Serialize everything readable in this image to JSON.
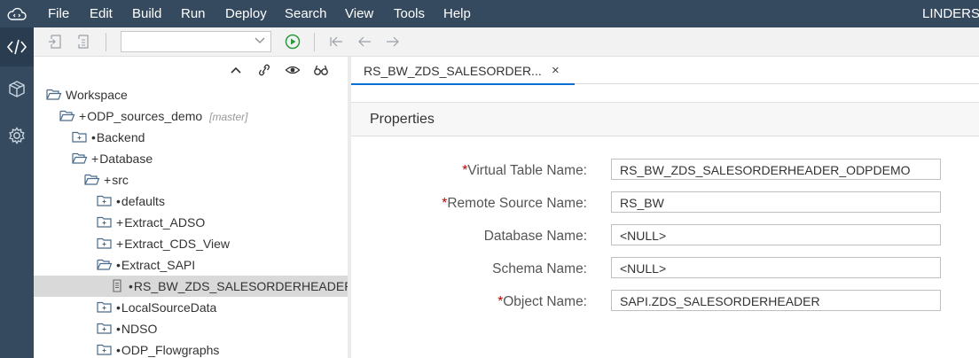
{
  "menubar": {
    "items": [
      "File",
      "Edit",
      "Build",
      "Run",
      "Deploy",
      "Search",
      "View",
      "Tools",
      "Help"
    ],
    "user": "LINDERS"
  },
  "sidebar": {
    "items": [
      {
        "icon": "code-icon",
        "active": true
      },
      {
        "icon": "package-icon",
        "active": false
      },
      {
        "icon": "gear-icon",
        "active": false
      }
    ]
  },
  "toolbar": {
    "combo_value": "",
    "icons": [
      "new-file-icon",
      "copy-file-icon",
      "run-icon",
      "jump-back-icon",
      "back-icon",
      "forward-icon"
    ]
  },
  "tree": {
    "rows": [
      {
        "label": "Workspace",
        "prefix": "",
        "icon": "folder-open",
        "branch": ""
      },
      {
        "label": "ODP_sources_demo",
        "prefix": "+",
        "icon": "folder-open",
        "branch": "[master]"
      },
      {
        "label": "Backend",
        "prefix": "•",
        "icon": "folder-closed",
        "branch": ""
      },
      {
        "label": "Database",
        "prefix": "+",
        "icon": "folder-open",
        "branch": ""
      },
      {
        "label": "src",
        "prefix": "+",
        "icon": "folder-open",
        "branch": ""
      },
      {
        "label": "defaults",
        "prefix": "•",
        "icon": "folder-closed",
        "branch": ""
      },
      {
        "label": "Extract_ADSO",
        "prefix": "+",
        "icon": "folder-closed",
        "branch": ""
      },
      {
        "label": "Extract_CDS_View",
        "prefix": "+",
        "icon": "folder-closed",
        "branch": ""
      },
      {
        "label": "Extract_SAPI",
        "prefix": "•",
        "icon": "folder-open",
        "branch": ""
      },
      {
        "label": "RS_BW_ZDS_SALESORDERHEADER_ODPDEMO.hdbvirtualtable",
        "prefix": "•",
        "icon": "file",
        "branch": "",
        "selected": true
      },
      {
        "label": "LocalSourceData",
        "prefix": "•",
        "icon": "folder-closed",
        "branch": ""
      },
      {
        "label": "NDSO",
        "prefix": "•",
        "icon": "folder-closed",
        "branch": ""
      },
      {
        "label": "ODP_Flowgraphs",
        "prefix": "•",
        "icon": "folder-closed",
        "branch": ""
      }
    ]
  },
  "editor": {
    "tab_label": "RS_BW_ZDS_SALESORDER...",
    "close_glyph": "×",
    "section_title": "Properties",
    "fields": [
      {
        "label": "Virtual Table Name:",
        "required": true,
        "value": "RS_BW_ZDS_SALESORDERHEADER_ODPDEMO"
      },
      {
        "label": "Remote Source Name:",
        "required": true,
        "value": "RS_BW"
      },
      {
        "label": "Database Name:",
        "required": false,
        "value": "<NULL>"
      },
      {
        "label": "Schema Name:",
        "required": false,
        "value": "<NULL>"
      },
      {
        "label": "Object Name:",
        "required": true,
        "value": "SAPI.ZDS_SALESORDERHEADER"
      }
    ]
  },
  "colors": {
    "shell": "#354a5f",
    "accent": "#0a6ed1",
    "required": "#bb0000",
    "run": "#2b9a3e",
    "folder_icon": "#4a6a8a"
  }
}
